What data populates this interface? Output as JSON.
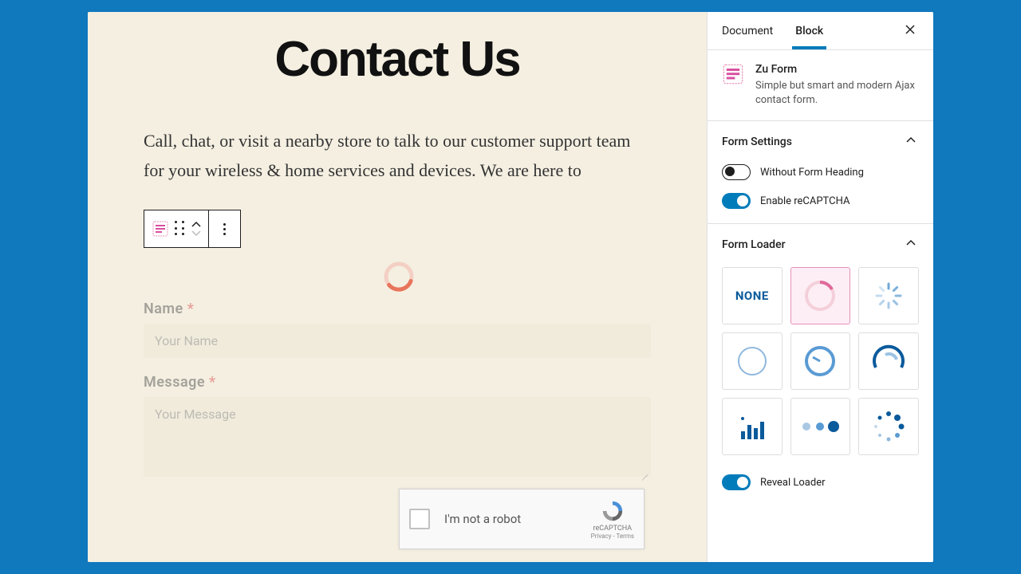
{
  "editor": {
    "page_title": "Contact Us",
    "intro": "Call, chat, or visit a nearby store to talk to our customer support team for your wireless & home services and devices. We are here to",
    "form": {
      "name_label": "Name",
      "name_placeholder": "Your Name",
      "message_label": "Message",
      "message_placeholder": "Your Message"
    },
    "recaptcha": {
      "label": "I'm not a robot",
      "brand": "reCAPTCHA",
      "links": "Privacy - Terms"
    }
  },
  "sidebar": {
    "tabs": {
      "document": "Document",
      "block": "Block"
    },
    "block": {
      "title": "Zu Form",
      "desc": "Simple but smart and modern Ajax contact form."
    },
    "form_settings": {
      "title": "Form Settings",
      "without_heading": "Without Form Heading",
      "enable_recaptcha": "Enable reCAPTCHA"
    },
    "form_loader": {
      "title": "Form Loader",
      "none_label": "NONE",
      "reveal": "Reveal Loader"
    }
  }
}
